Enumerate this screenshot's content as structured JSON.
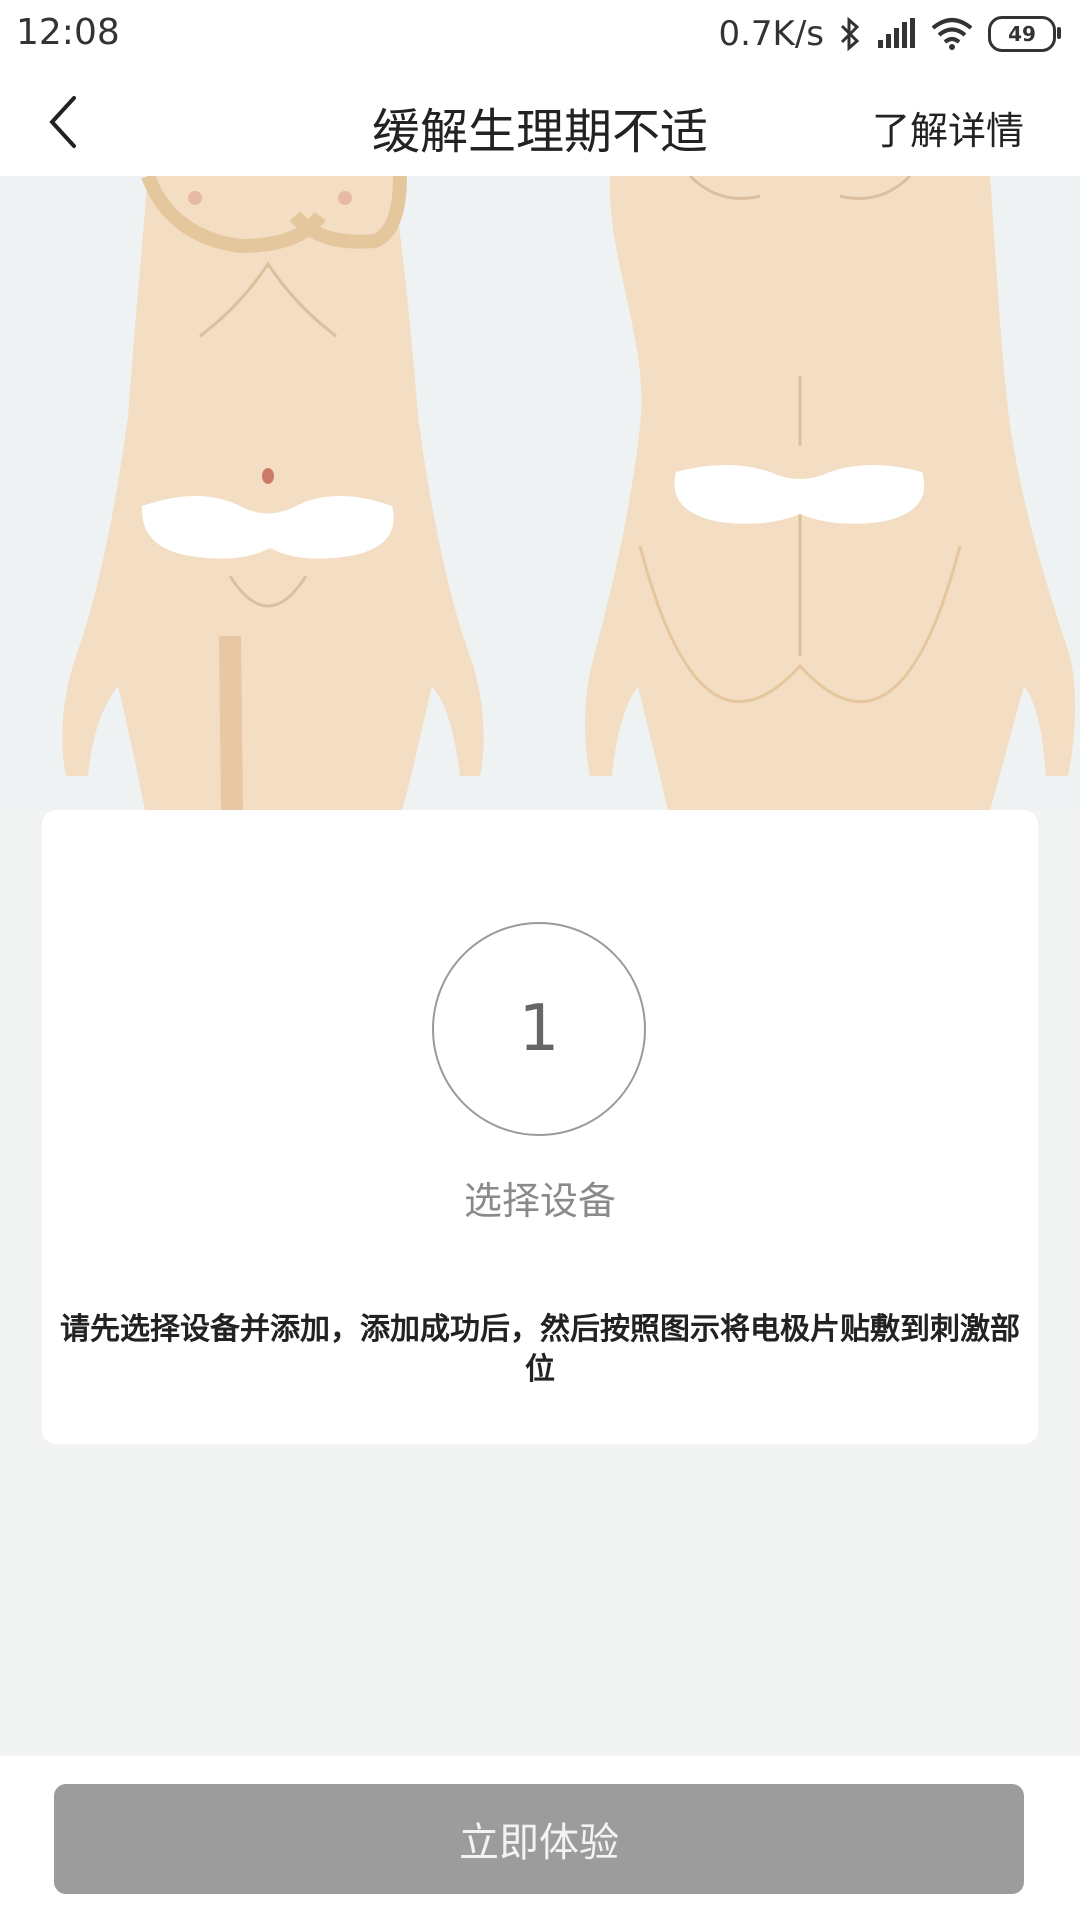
{
  "status_bar": {
    "time": "12:08",
    "net_speed": "0.7K/s",
    "battery": "49",
    "icons": [
      "bluetooth-icon",
      "signal-icon",
      "wifi-icon",
      "battery-icon"
    ]
  },
  "nav": {
    "back_icon": "chevron-left-icon",
    "title": "缓解生理期不适",
    "link": "了解详情"
  },
  "illustration": {
    "views": [
      "front-body",
      "back-body"
    ],
    "pad_color": "#ffffff",
    "skin_color": "#f3ddc3"
  },
  "card": {
    "step_number": "1",
    "step_label": "选择设备",
    "instruction": "请先选择设备并添加，添加成功后，然后按照图示将电极片贴敷到刺激部位"
  },
  "footer": {
    "cta_label": "立即体验",
    "cta_color": "#9c9c9c"
  }
}
